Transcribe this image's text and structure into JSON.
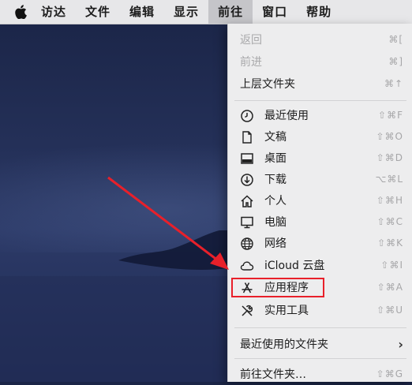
{
  "menubar": {
    "apple_icon": "apple-logo-icon",
    "items": [
      "访达",
      "文件",
      "编辑",
      "显示",
      "前往",
      "窗口",
      "帮助"
    ],
    "active_index": 4
  },
  "go_menu": {
    "back": {
      "label": "返回",
      "shortcut": "⌘["
    },
    "forward": {
      "label": "前进",
      "shortcut": "⌘]"
    },
    "enclosing": {
      "label": "上层文件夹",
      "shortcut": "⌘↑"
    },
    "recents": {
      "label": "最近使用",
      "shortcut": "⇧⌘F",
      "icon": "clock-icon"
    },
    "documents": {
      "label": "文稿",
      "shortcut": "⇧⌘O",
      "icon": "document-icon"
    },
    "desktop": {
      "label": "桌面",
      "shortcut": "⇧⌘D",
      "icon": "desktop-icon"
    },
    "downloads": {
      "label": "下载",
      "shortcut": "⌥⌘L",
      "icon": "download-icon"
    },
    "home": {
      "label": "个人",
      "shortcut": "⇧⌘H",
      "icon": "home-icon"
    },
    "computer": {
      "label": "电脑",
      "shortcut": "⇧⌘C",
      "icon": "computer-icon"
    },
    "network": {
      "label": "网络",
      "shortcut": "⇧⌘K",
      "icon": "network-icon"
    },
    "icloud": {
      "label": "iCloud 云盘",
      "shortcut": "⇧⌘I",
      "icon": "cloud-icon"
    },
    "applications": {
      "label": "应用程序",
      "shortcut": "⇧⌘A",
      "icon": "applications-icon"
    },
    "utilities": {
      "label": "实用工具",
      "shortcut": "⇧⌘U",
      "icon": "tools-icon"
    },
    "recent_folders": {
      "label": "最近使用的文件夹",
      "chevron": "›"
    },
    "go_to_folder": {
      "label": "前往文件夹…",
      "shortcut": "⇧⌘G"
    }
  },
  "annotation": {
    "color": "#e8202a"
  }
}
